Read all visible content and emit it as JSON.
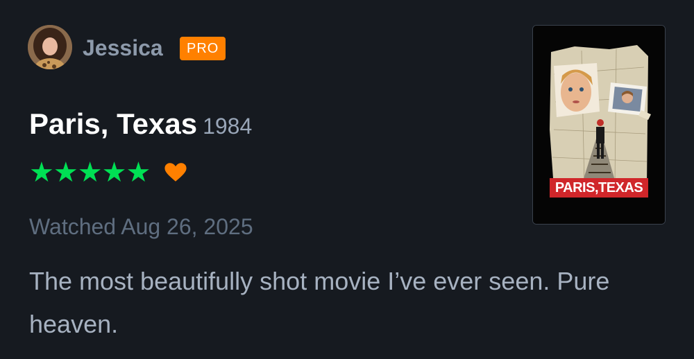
{
  "user": {
    "name": "Jessica",
    "badge": "PRO",
    "avatar_icon": "avatar-photo"
  },
  "film": {
    "title": "Paris, Texas",
    "year": "1984",
    "poster_text": "PARIS,TEXAS"
  },
  "rating": {
    "stars": 5,
    "stars_text": "★★★★★",
    "liked": true,
    "star_color": "#00e054",
    "heart_color": "#ff8000"
  },
  "watched": "Watched Aug 26, 2025",
  "review": {
    "text": "The most beautifully shot movie I’ve ever seen. Pure heaven."
  },
  "colors": {
    "background": "#161a20",
    "badge": "#ff8000",
    "title": "#ffffff",
    "muted": "#8d9aab"
  }
}
